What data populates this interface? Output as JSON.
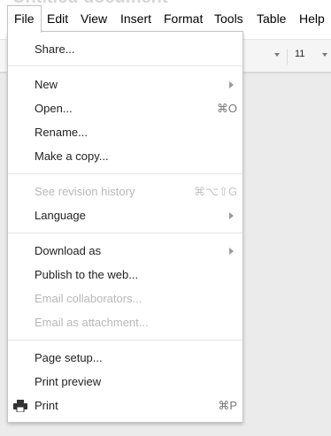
{
  "document": {
    "title": "Untitled document"
  },
  "menubar": {
    "items": [
      {
        "label": "File"
      },
      {
        "label": "Edit"
      },
      {
        "label": "View"
      },
      {
        "label": "Insert"
      },
      {
        "label": "Format"
      },
      {
        "label": "Tools"
      },
      {
        "label": "Table"
      },
      {
        "label": "Help"
      }
    ]
  },
  "toolbar": {
    "font_size": "11"
  },
  "file_menu": {
    "share": {
      "label": "Share..."
    },
    "new": {
      "label": "New"
    },
    "open": {
      "label": "Open...",
      "shortcut": "⌘O"
    },
    "rename": {
      "label": "Rename..."
    },
    "make_copy": {
      "label": "Make a copy..."
    },
    "revision_history": {
      "label": "See revision history",
      "shortcut": "⌘⌥⇧G"
    },
    "language": {
      "label": "Language"
    },
    "download_as": {
      "label": "Download as"
    },
    "publish": {
      "label": "Publish to the web..."
    },
    "email_collaborators": {
      "label": "Email collaborators..."
    },
    "email_attachment": {
      "label": "Email as attachment..."
    },
    "page_setup": {
      "label": "Page setup..."
    },
    "print_preview": {
      "label": "Print preview"
    },
    "print": {
      "label": "Print",
      "shortcut": "⌘P"
    }
  },
  "icons": {
    "submenu": "chevron-right-icon",
    "print": "printer-icon"
  }
}
